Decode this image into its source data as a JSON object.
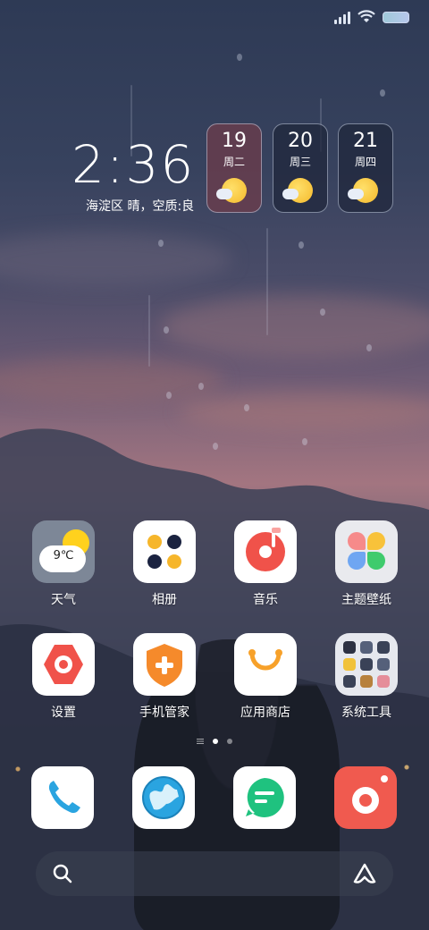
{
  "status_bar": {
    "signal": "signal-icon",
    "wifi": "wifi-icon",
    "battery": "battery-icon"
  },
  "clock": {
    "time": "2:36",
    "subtitle": "海淀区 晴，空质:良"
  },
  "weather_cards": [
    {
      "day": "19",
      "weekday": "周二",
      "icon": "sunny-cloud-icon"
    },
    {
      "day": "20",
      "weekday": "周三",
      "icon": "sunny-cloud-icon"
    },
    {
      "day": "21",
      "weekday": "周四",
      "icon": "sunny-cloud-icon"
    }
  ],
  "apps": [
    {
      "label": "天气",
      "icon": "weather-icon",
      "temp": "9℃"
    },
    {
      "label": "相册",
      "icon": "gallery-icon"
    },
    {
      "label": "音乐",
      "icon": "music-icon"
    },
    {
      "label": "主题壁纸",
      "icon": "themes-icon"
    },
    {
      "label": "设置",
      "icon": "settings-icon"
    },
    {
      "label": "手机管家",
      "icon": "security-icon"
    },
    {
      "label": "应用商店",
      "icon": "app-store-icon"
    },
    {
      "label": "系统工具",
      "icon": "tools-folder-icon"
    }
  ],
  "dock": [
    {
      "icon": "phone-icon"
    },
    {
      "icon": "browser-icon"
    },
    {
      "icon": "messages-icon"
    },
    {
      "icon": "camera-icon"
    }
  ],
  "search_bar": {
    "search_icon": "search-icon",
    "assistant_icon": "assistant-icon"
  },
  "colors": {
    "accent_red": "#f0524a",
    "accent_orange": "#f58a2b",
    "accent_green": "#1fc27f",
    "accent_blue": "#2aa4e0",
    "accent_yellow": "#f6b62b"
  }
}
